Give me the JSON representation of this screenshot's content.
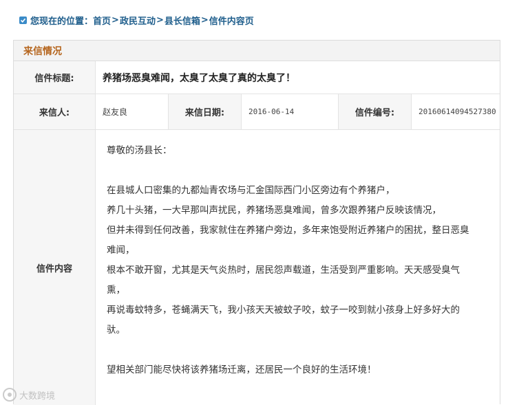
{
  "breadcrumb": {
    "prefix": "您现在的位置：",
    "items": [
      "首页",
      "政民互动",
      "县长信箱",
      "信件内容页"
    ],
    "separator": ">"
  },
  "panel": {
    "header": "来信情况",
    "title_label": "信件标题:",
    "title_value": "养猪场恶臭难闻，太臭了太臭了真的太臭了！",
    "sender_label": "来信人:",
    "sender_value": "赵友良",
    "date_label": "来信日期:",
    "date_value": "2016-06-14",
    "id_label": "信件编号:",
    "id_value": "20160614094527380",
    "content_label": "信件内容",
    "content_lines": [
      "尊敬的汤县长：",
      "",
      "在县城人口密集的九都灿青农场与汇金国际西门小区旁边有个养猪户，",
      "养几十头猪，一大早那叫声扰民，养猪场恶臭难闻，曾多次跟养猪户反映该情况，",
      "但并未得到任何改善，我家就住在养猪户旁边，多年来饱受附近养猪户的困扰，整日恶臭",
      "难闻，",
      "根本不敢开窗，尤其是天气炎热时，居民怨声载道，生活受到严重影响。天天感受臭气",
      "熏，",
      "再说毒蚊特多，苍蝇满天飞，我小孩天天被蚊子咬，蚊子一咬到就小孩身上好多好大的",
      "驮。",
      "",
      "望相关部门能尽快将该养猪场迁离，还居民一个良好的生活环境！"
    ]
  },
  "watermark": "大数跨境",
  "colors": {
    "breadcrumb": "#1f5e8c",
    "header_text": "#b5651d",
    "label_bg": "#f6f6f6",
    "border": "#e3e3e3"
  }
}
